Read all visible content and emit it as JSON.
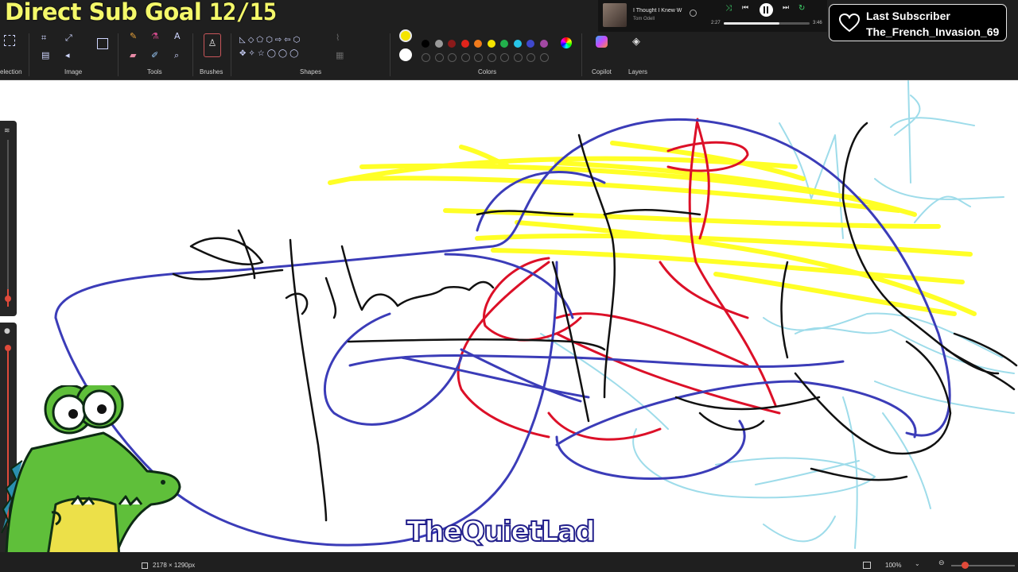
{
  "overlay": {
    "sub_goal_label": "Direct Sub Goal",
    "sub_goal_count": "12/15",
    "last_subscriber_title": "Last Subscriber",
    "last_subscriber_name": "The_French_Invasion_69",
    "watermark": "TheQuietLad"
  },
  "music_player": {
    "song_title": "I Thought I Knew W",
    "artist": "Tom Odell",
    "time_current": "2:27",
    "time_total": "3:46",
    "progress": 0.65
  },
  "ribbon": {
    "groups": [
      {
        "label": "election",
        "icon": "selection-icon"
      },
      {
        "label": "Image",
        "icon": "image-icon"
      },
      {
        "label": "Tools",
        "icon": "pencil-icon"
      },
      {
        "label": "Brushes",
        "icon": "brush-icon"
      },
      {
        "label": "Shapes",
        "icon": "shapes-icon"
      },
      {
        "label": "Colors",
        "icon": "palette-icon"
      },
      {
        "label": "Copilot",
        "icon": "copilot-icon"
      },
      {
        "label": "Layers",
        "icon": "layers-icon"
      }
    ],
    "text_tool_glyph": "A",
    "active_color": "#f5e400",
    "secondary_color": "#ffffff",
    "palette_row1": [
      "#000000",
      "#9a9a9a",
      "#8b1a1a",
      "#e0241b",
      "#f07b1c",
      "#f5e400",
      "#22b14c",
      "#27c4e8",
      "#3f48cc",
      "#a349a4"
    ],
    "palette_row2": [
      "#ffffff",
      "#c3c3c3",
      "#b97a57",
      "#ffaec9",
      "#ffc90e",
      "#efe4b0",
      "#b5e61d",
      "#99d9ea",
      "#7092be",
      "#c8bfe7"
    ]
  },
  "status_bar": {
    "canvas_size": "2178 × 1290px",
    "zoom": "100%"
  },
  "drawing_colors": {
    "black": "#111111",
    "blue": "#3b3cb8",
    "red": "#dc1028",
    "yellow": "#ffff1a",
    "lightblue": "#9edcea"
  }
}
